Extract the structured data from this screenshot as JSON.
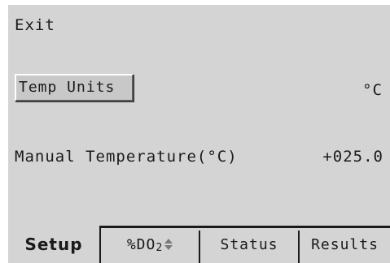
{
  "menu": {
    "exit_label": "Exit"
  },
  "settings": {
    "temp_units_label": "Temp Units",
    "temp_units_value": "°C",
    "manual_temp_label": "Manual Temperature(°C)",
    "manual_temp_value": "+025.0"
  },
  "tabs": [
    {
      "label": "Setup",
      "selected": true
    },
    {
      "label": "%DO",
      "subscript": "2",
      "icon": "up-down-arrow-icon",
      "selected": false
    },
    {
      "label": "Status",
      "selected": false
    },
    {
      "label": "Results",
      "selected": false
    }
  ],
  "colors": {
    "background": "#d4d4d4",
    "text": "#1a1a1a"
  }
}
